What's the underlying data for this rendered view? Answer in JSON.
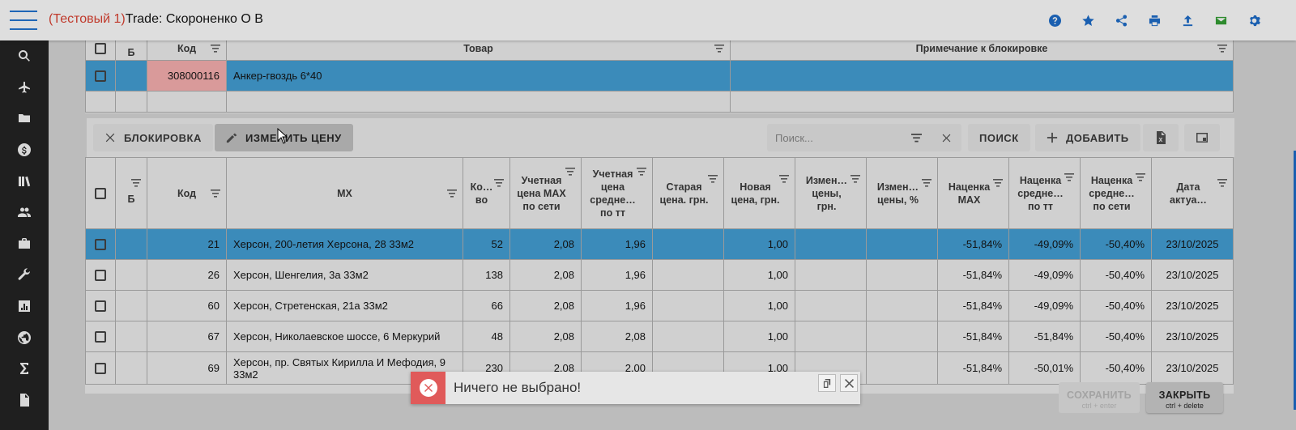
{
  "header": {
    "title_prefix": "(Тестовый 1)",
    "title_main": "Trade: Скороненко О В"
  },
  "top_icons": [
    "help-icon",
    "star-icon",
    "share-icon",
    "print-icon",
    "upload-icon",
    "mail-icon",
    "settings-icon"
  ],
  "sidebar": {
    "items": [
      "search-icon",
      "plane-icon",
      "folder-icon",
      "dollar-icon",
      "books-icon",
      "people-icon",
      "briefcase-icon",
      "wrench-icon",
      "chart-icon",
      "globe-icon",
      "sigma-icon",
      "document-icon"
    ]
  },
  "top_table": {
    "headers": {
      "b": "Б",
      "code": "Код",
      "product": "Товар",
      "note": "Примечание к блокировке"
    },
    "rows": [
      {
        "code": "308000116",
        "product": "Анкер-гвоздь 6*40",
        "note": ""
      }
    ]
  },
  "toolbar": {
    "block_label": "БЛОКИРОВКА",
    "change_price_label": "ИЗМЕНИТЬ ЦЕНУ",
    "search_placeholder": "Поиск...",
    "search_label": "ПОИСК",
    "add_label": "ДОБАВИТЬ"
  },
  "main_table": {
    "headers": {
      "b": "Б",
      "code": "Код",
      "mh": "МХ",
      "qty": "Ко… во",
      "price_max": "Учетная цена MAX по сети",
      "price_avg": "Учетная цена средне… по тт",
      "old_price": "Старая цена. грн.",
      "new_price": "Новая цена, грн.",
      "change_uah": "Измен… цены, грн.",
      "change_pct": "Измен… цены, %",
      "markup_max": "Наценка MAX",
      "markup_avg_tt": "Наценка средне… по тт",
      "markup_avg_net": "Наценка средне… по сети",
      "date": "Дата актуа…"
    },
    "rows": [
      {
        "code": "21",
        "mh": "Херсон, 200-летия Херсона, 28 33м2",
        "qty": "52",
        "price_max": "2,08",
        "price_avg": "1,96",
        "old_price": "",
        "new_price": "1,00",
        "change_uah": "",
        "change_pct": "",
        "markup_max": "-51,84%",
        "markup_avg_tt": "-49,09%",
        "markup_avg_net": "-50,40%",
        "date": "23/10/2025"
      },
      {
        "code": "26",
        "mh": "Херсон, Шенгелия, 3а 33м2",
        "qty": "138",
        "price_max": "2,08",
        "price_avg": "1,96",
        "old_price": "",
        "new_price": "1,00",
        "change_uah": "",
        "change_pct": "",
        "markup_max": "-51,84%",
        "markup_avg_tt": "-49,09%",
        "markup_avg_net": "-50,40%",
        "date": "23/10/2025"
      },
      {
        "code": "60",
        "mh": "Херсон, Стретенская, 21а 33м2",
        "qty": "66",
        "price_max": "2,08",
        "price_avg": "1,96",
        "old_price": "",
        "new_price": "1,00",
        "change_uah": "",
        "change_pct": "",
        "markup_max": "-51,84%",
        "markup_avg_tt": "-49,09%",
        "markup_avg_net": "-50,40%",
        "date": "23/10/2025"
      },
      {
        "code": "67",
        "mh": "Херсон, Николаевское шоссе, 6 Меркурий",
        "qty": "48",
        "price_max": "2,08",
        "price_avg": "2,08",
        "old_price": "",
        "new_price": "1,00",
        "change_uah": "",
        "change_pct": "",
        "markup_max": "-51,84%",
        "markup_avg_tt": "-51,84%",
        "markup_avg_net": "-50,40%",
        "date": "23/10/2025"
      },
      {
        "code": "69",
        "mh": "Херсон, пр. Святых Кирилла И Мефодия, 9 33м2",
        "qty": "230",
        "price_max": "2,08",
        "price_avg": "2,00",
        "old_price": "",
        "new_price": "1,00",
        "change_uah": "",
        "change_pct": "",
        "markup_max": "-51,84%",
        "markup_avg_tt": "-50,01%",
        "markup_avg_net": "-50,40%",
        "date": "23/10/2025"
      }
    ]
  },
  "footer": {
    "save_label": "СОХРАНИТЬ",
    "save_shortcut": "ctrl + enter",
    "close_label": "ЗАКРЫТЬ",
    "close_shortcut": "ctrl + delete"
  },
  "toast": {
    "message": "Ничего не выбрано!"
  }
}
